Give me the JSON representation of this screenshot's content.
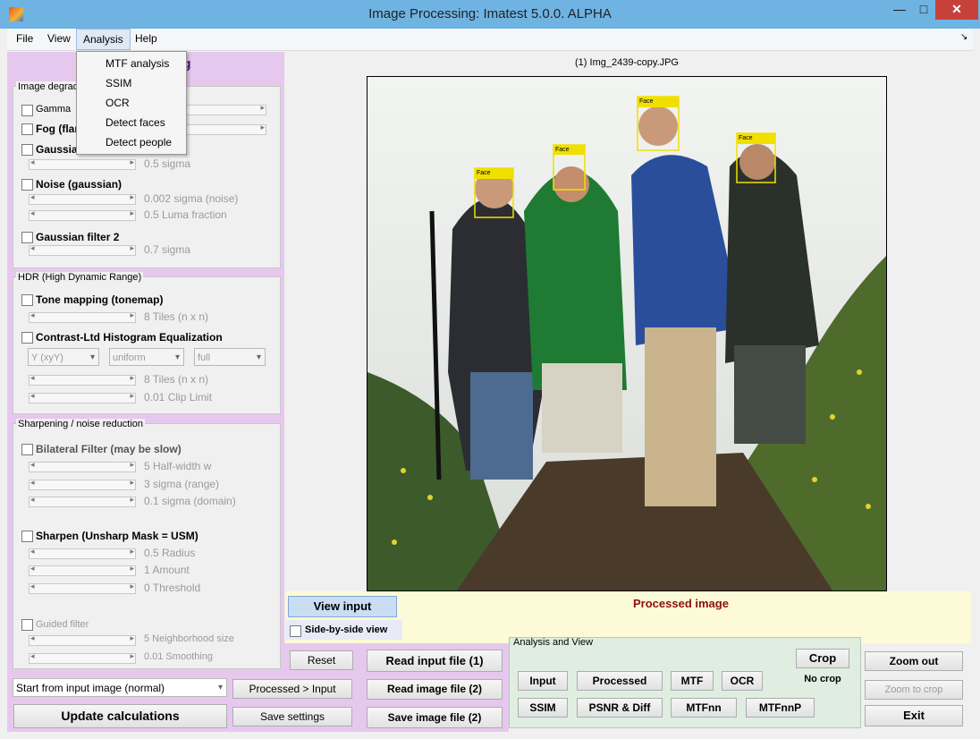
{
  "window": {
    "title": "Image Processing:  Imatest 5.0.0. ALPHA",
    "min": "—",
    "max": "□",
    "close": "✕"
  },
  "menubar": {
    "items": [
      "File",
      "View",
      "Analysis",
      "Help"
    ],
    "pin": "↘"
  },
  "analysis_menu": {
    "items": [
      "MTF analysis",
      "SSIM",
      "OCR",
      "Detect faces",
      "Detect people"
    ]
  },
  "left_panel": {
    "header": "ing",
    "degradation": {
      "title": "Image degrad",
      "gamma": "Gamma",
      "gamma_suffix": "(",
      "fog": "Fog (flar",
      "gaussian": "Gaussia",
      "gaussian_sigma": "0.5  sigma",
      "noise": "Noise (gaussian)",
      "noise_sigma": "0.002  sigma (noise)",
      "noise_luma": "0.5  Luma fraction",
      "gauss2": "Gaussian filter 2",
      "gauss2_sigma": "0.7  sigma"
    },
    "hdr": {
      "title": "HDR (High Dynamic Range)",
      "tonemap": "Tone mapping (tonemap)",
      "tonemap_tiles": "8  Tiles (n x n)",
      "clahe": "Contrast-Ltd Histogram Equalization",
      "dd1": "Y (xyY)",
      "dd2": "uniform",
      "dd3": "full",
      "clahe_tiles": "8  Tiles (n x n)",
      "clahe_clip": "0.01  Clip Limit"
    },
    "sharpen": {
      "title": "Sharpening / noise reduction",
      "bilateral": "Bilateral Filter  (may be slow)",
      "bil_w": "5  Half-width w",
      "bil_range": "3  sigma (range)",
      "bil_domain": "0.1  sigma (domain)",
      "usm": "Sharpen (Unsharp Mask = USM)",
      "usm_radius": "0.5  Radius",
      "usm_amount": "1  Amount",
      "usm_threshold": "0  Threshold",
      "guided": "Guided filter",
      "guided_size": "5  Neighborhood size",
      "guided_smooth": "0.01  Smoothing"
    },
    "start_select": "Start from input image (normal)",
    "update_btn": "Update calculations"
  },
  "image": {
    "filename": "(1) Img_2439-copy.JPG",
    "face_label": "Face"
  },
  "bottom": {
    "view_input": "View input",
    "processed_title": "Processed image",
    "side_by_side": "Side-by-side view",
    "reset": "Reset",
    "processed_input": "Processed > Input",
    "save_settings": "Save settings",
    "read_input": "Read input file (1)",
    "read_image2": "Read image file (2)",
    "save_image2": "Save image file (2)",
    "analysis_title": "Analysis and View",
    "crop": "Crop",
    "no_crop": "No crop",
    "input": "Input",
    "processed": "Processed",
    "mtf": "MTF",
    "ocr": "OCR",
    "ssim": "SSIM",
    "psnr": "PSNR & Diff",
    "mtfnn": "MTFnn",
    "mtfnnp": "MTFnnP",
    "zoom_out": "Zoom out",
    "zoom_crop": "Zoom to crop",
    "exit": "Exit"
  }
}
